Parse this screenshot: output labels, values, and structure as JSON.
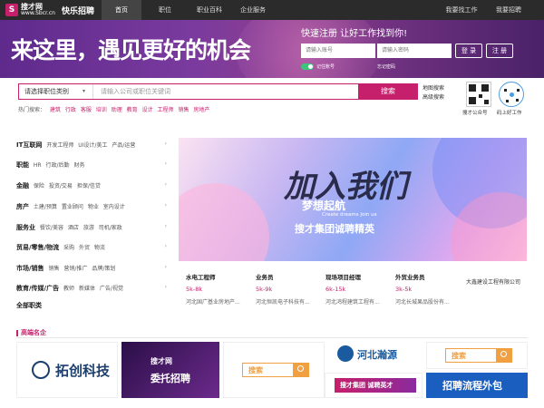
{
  "nav": {
    "logo_mark": "S",
    "logo_name": "搜才网",
    "logo_url": "www.Sbcr.cn",
    "slogan": "快乐招聘",
    "tabs": [
      "首页",
      "职位",
      "职业百科",
      "企业服务"
    ],
    "find_job": "我要找工作",
    "hire": "我要招聘"
  },
  "banner": {
    "slogan": "来这里，遇见更好的机会",
    "register_title": "快速注册 让好工作找到你!",
    "account_placeholder": "请输入账号",
    "password_placeholder": "请输入密码",
    "login": "登 录",
    "register": "注 册",
    "remember": "记住账号",
    "forgot": "忘记密码"
  },
  "search": {
    "category": "请选择职位类别",
    "keyword_placeholder": "请输入公司或职位关键词",
    "button": "搜索",
    "map_search": "地图搜索",
    "advanced_search": "高级搜索",
    "hot_label": "热门搜索：",
    "hot_keywords": [
      "建筑",
      "行政",
      "客服",
      "培训",
      "助理",
      "教育",
      "设计",
      "工程师",
      "销售",
      "房地产"
    ],
    "qr1_label": "搜才公众号",
    "qr2_label": "码上好工作"
  },
  "categories": [
    {
      "title": "IT互联网",
      "subs": [
        "开发工程师",
        "UI设计/美工",
        "产品/运营"
      ]
    },
    {
      "title": "职能",
      "subs": [
        "HR",
        "行政/后勤",
        "财务"
      ]
    },
    {
      "title": "金融",
      "subs": [
        "保险",
        "投资/交易",
        "担保/信贷"
      ]
    },
    {
      "title": "房产",
      "subs": [
        "土建/预算",
        "置业顾问",
        "物业",
        "室内设计"
      ]
    },
    {
      "title": "服务业",
      "subs": [
        "餐饮/美容",
        "酒店",
        "旅游",
        "司机/家政"
      ]
    },
    {
      "title": "贸易/零售/物流",
      "subs": [
        "采购",
        "外贸",
        "物流"
      ]
    },
    {
      "title": "市场/销售",
      "subs": [
        "销售",
        "营销/推广",
        "品牌/策划"
      ]
    },
    {
      "title": "教育/传媒/广告",
      "subs": [
        "教师",
        "新媒体",
        "广告/视觉"
      ]
    }
  ],
  "all_categories": "全部职类",
  "hero": {
    "title": "加入我们",
    "subtitle": "梦想起航",
    "english": "Create dreams   Join us",
    "corp": "搜才集团诚聘精英"
  },
  "jobs": [
    {
      "title": "水电工程师",
      "salary": "5k-8k",
      "company": "河北国广基业房地产..."
    },
    {
      "title": "业务员",
      "salary": "5k-9k",
      "company": "河北恒凯电子科技有..."
    },
    {
      "title": "现场项目经理",
      "salary": "6k-15k",
      "company": "河北鸿程建筑工程有..."
    },
    {
      "title": "外贸业务员",
      "salary": "3k-5k",
      "company": "河北长城果品股份有..."
    }
  ],
  "job5_company": "大鑫建设工程有限公司",
  "famous": {
    "title": "高端名企",
    "tuochuang": "拓创科技",
    "weituo_mark": "搜才网",
    "weituo": "委托招聘",
    "search_word": "搜索",
    "hbhy": "河北瀚源",
    "sczc": "搜才集团 诚聘英才",
    "lc": "招聘流程外包"
  }
}
